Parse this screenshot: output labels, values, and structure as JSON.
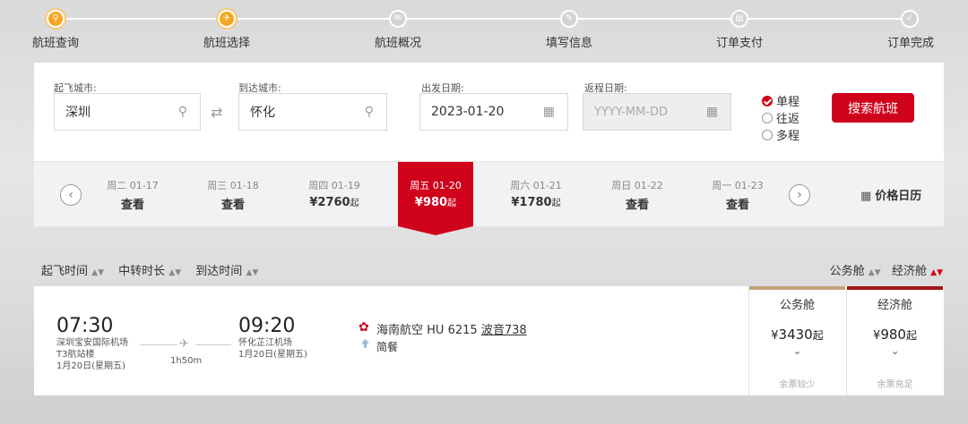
{
  "steps": [
    {
      "label": "航班查询",
      "icon": "search-icon"
    },
    {
      "label": "航班选择",
      "icon": "plane-icon"
    },
    {
      "label": "航班概况",
      "icon": "mail-icon"
    },
    {
      "label": "填写信息",
      "icon": "pencil-icon"
    },
    {
      "label": "订单支付",
      "icon": "document-icon"
    },
    {
      "label": "订单完成",
      "icon": "check-icon"
    }
  ],
  "search": {
    "from_label": "起飞城市:",
    "from_value": "深圳",
    "to_label": "到达城市:",
    "to_value": "怀化",
    "depart_label": "出发日期:",
    "depart_value": "2023-01-20",
    "return_label": "返程日期:",
    "return_placeholder": "YYYY-MM-DD",
    "trip_types": [
      "单程",
      "往返",
      "多程"
    ],
    "selected_trip": "单程",
    "search_button": "搜索航班"
  },
  "date_strip": {
    "days": [
      {
        "date": "周二 01-17",
        "price": "查看",
        "suffix": ""
      },
      {
        "date": "周三 01-18",
        "price": "查看",
        "suffix": ""
      },
      {
        "date": "周四 01-19",
        "price": "¥2760",
        "suffix": "起"
      },
      {
        "date": "周五 01-20",
        "price": "¥980",
        "suffix": "起"
      },
      {
        "date": "周六 01-21",
        "price": "¥1780",
        "suffix": "起"
      },
      {
        "date": "周日 01-22",
        "price": "查看",
        "suffix": ""
      },
      {
        "date": "周一 01-23",
        "price": "查看",
        "suffix": ""
      }
    ],
    "active_index": 3,
    "price_calendar": "价格日历"
  },
  "sort": {
    "items": [
      "起飞时间",
      "中转时长",
      "到达时间"
    ],
    "cabins": [
      "公务舱",
      "经济舱"
    ]
  },
  "flight": {
    "depart_time": "07:30",
    "depart_airport": "深圳宝安国际机场",
    "depart_terminal": "T3航站楼",
    "depart_date": "1月20日(星期五)",
    "duration": "1h50m",
    "arrive_time": "09:20",
    "arrive_airport": "怀化芷江机场",
    "arrive_date": "1月20日(星期五)",
    "airline": "海南航空",
    "flight_no": "HU 6215",
    "aircraft": "波音738",
    "meal": "简餐",
    "cabins": [
      {
        "name": "公务舱",
        "currency": "¥",
        "price": "3430",
        "suffix": "起",
        "status": "余票较少",
        "color": "#c8a27a"
      },
      {
        "name": "经济舱",
        "currency": "¥",
        "price": "980",
        "suffix": "起",
        "status": "余票充足",
        "color": "#a31515"
      }
    ]
  }
}
